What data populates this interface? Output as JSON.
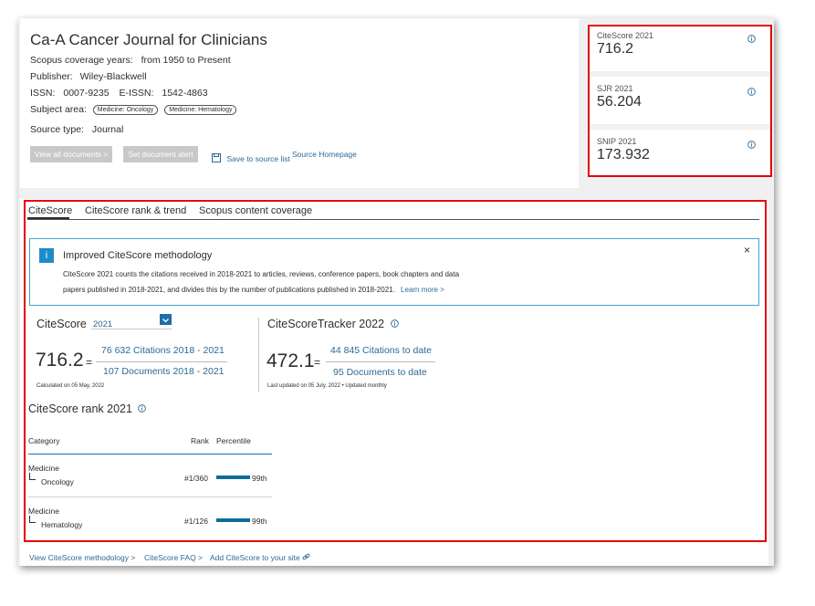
{
  "source": {
    "title": "Ca-A Cancer Journal for Clinicians",
    "coverage_label": "Scopus coverage years:",
    "coverage_value": "from 1950 to Present",
    "publisher_label": "Publisher:",
    "publisher_value": "Wiley-Blackwell",
    "issn_label": "ISSN:",
    "issn_value": "0007-9235",
    "eissn_label": "E-ISSN:",
    "eissn_value": "1542-4863",
    "subject_label": "Subject area:",
    "subjects": [
      "Medicine: Oncology",
      "Medicine: Hematology"
    ],
    "type_label": "Source type:",
    "type_value": "Journal",
    "buttons": {
      "view_all": "View all documents >",
      "set_alert": "Set document alert",
      "save": "Save to source list",
      "homepage": "Source Homepage"
    }
  },
  "metrics": [
    {
      "label": "CiteScore 2021",
      "value": "716.2"
    },
    {
      "label": "SJR 2021",
      "value": "56.204"
    },
    {
      "label": "SNIP 2021",
      "value": "173.932"
    }
  ],
  "tabs": [
    "CiteScore",
    "CiteScore rank & trend",
    "Scopus content coverage"
  ],
  "notice": {
    "title": "Improved CiteScore methodology",
    "line1": "CiteScore 2021 counts the citations received in 2018-2021 to articles, reviews, conference papers, book chapters and data",
    "line2": "papers published in 2018-2021, and divides this by the number of publications published in 2018-2021.",
    "learn_more": "Learn more >",
    "close": "×"
  },
  "citescore": {
    "title": "CiteScore",
    "year": "2021",
    "value": "716.2",
    "eq": "=",
    "numerator": "76 632 Citations 2018 - 2021",
    "denominator": "107 Documents 2018 - 2021",
    "calc_note": "Calculated on 05 May, 2022"
  },
  "tracker": {
    "title": "CiteScoreTracker 2022",
    "value": "472.1",
    "eq": "=",
    "numerator": "44 845 Citations to date",
    "denominator": "95 Documents to date",
    "note": "Last updated on 05 July, 2022 • Updated monthly"
  },
  "rank": {
    "title": "CiteScore rank 2021",
    "headers": {
      "category": "Category",
      "rank": "Rank",
      "percentile": "Percentile"
    },
    "rows": [
      {
        "category": "Medicine",
        "sub": "Oncology",
        "rank": "#1/360",
        "percentile": "99th",
        "percentile_value": 99
      },
      {
        "category": "Medicine",
        "sub": "Hematology",
        "rank": "#1/126",
        "percentile": "99th",
        "percentile_value": 99
      }
    ]
  },
  "footer": {
    "methodology": "View CiteScore methodology >",
    "faq": "CiteScore FAQ >",
    "add": "Add CiteScore to your site"
  },
  "colors": {
    "link": "#2c6a96",
    "accent": "#0f6d99",
    "highlight": "#e30000",
    "info": "#1f8ac9"
  }
}
